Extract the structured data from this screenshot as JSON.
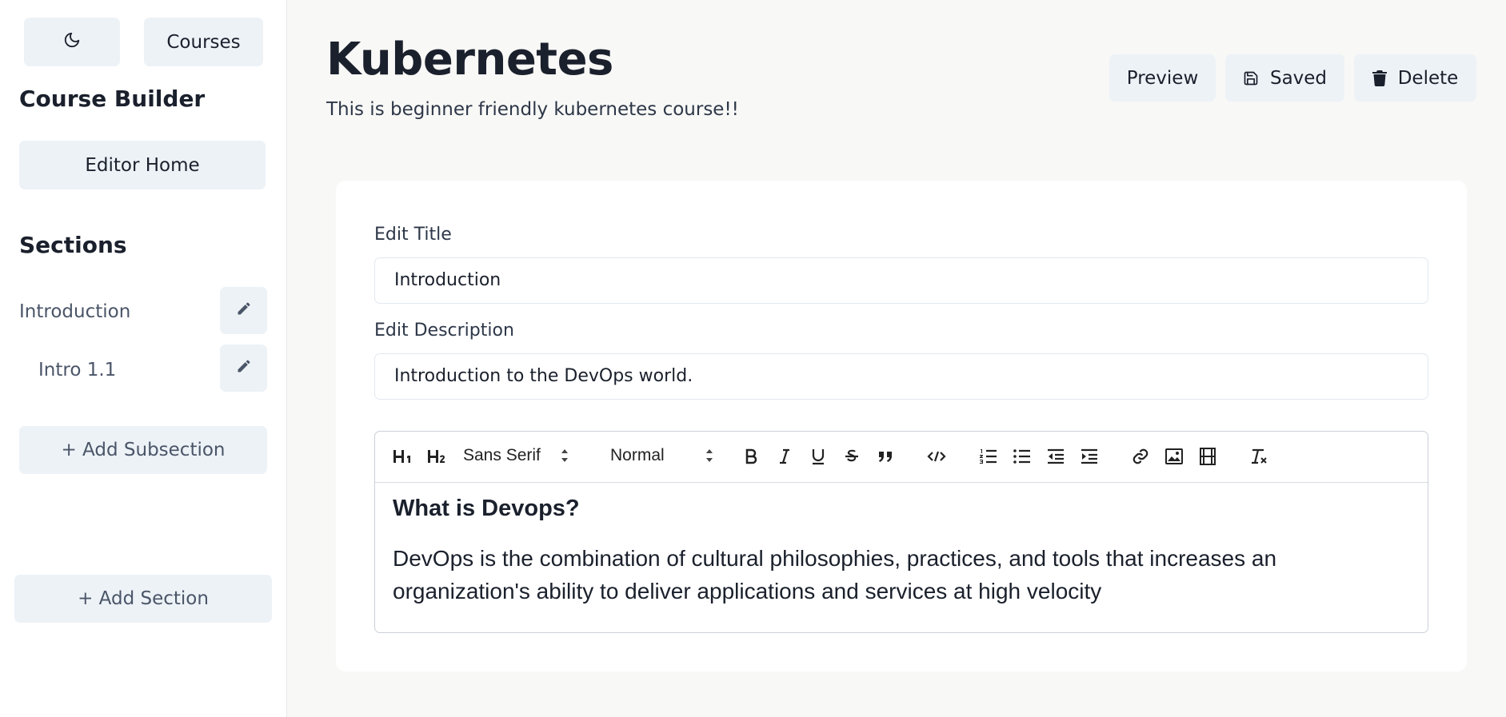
{
  "sidebar": {
    "theme_toggle_label": "",
    "courses_label": "Courses",
    "title": "Course Builder",
    "editor_home_label": "Editor Home",
    "sections_heading": "Sections",
    "items": [
      {
        "label": "Introduction"
      },
      {
        "label": "Intro 1.1"
      }
    ],
    "add_subsection_label": "+ Add Subsection",
    "add_section_label": "+ Add Section"
  },
  "header": {
    "title": "Kubernetes",
    "description": "This is beginner friendly kubernetes course!!",
    "preview_label": "Preview",
    "saved_label": "Saved",
    "delete_label": "Delete"
  },
  "form": {
    "title_label": "Edit Title",
    "title_value": "Introduction",
    "description_label": "Edit Description",
    "description_value": "Introduction to the DevOps world."
  },
  "editor": {
    "font_family": "Sans Serif",
    "font_size": "Normal",
    "content_heading": "What is Devops?",
    "content_paragraph": "DevOps is the combination of cultural philosophies, practices, and tools that increases an organization's ability to deliver applications and services at high velocity"
  },
  "icons": {
    "theme": "moon-icon",
    "edit": "pencil-icon",
    "save": "floppy-icon",
    "delete": "trash-icon"
  }
}
